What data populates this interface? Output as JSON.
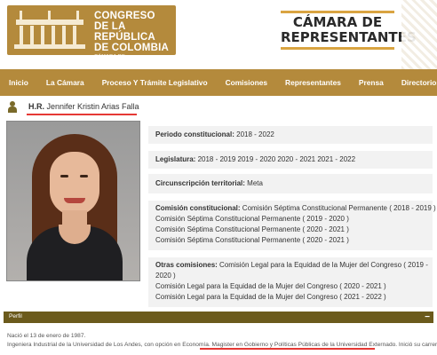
{
  "header": {
    "logo_line1": "CONGRESO",
    "logo_line2": "DE LA REPÚBLICA",
    "logo_line3": "DE COLOMBIA",
    "logo_line4": "CÁMARA DE REPRESENTANTES",
    "chamber_line1": "CÁMARA DE",
    "chamber_line2": "REPRESENTANTES"
  },
  "nav": {
    "items": [
      "Inicio",
      "La Cámara",
      "Proceso Y Trámite Legislativo",
      "Comisiones",
      "Representantes",
      "Prensa",
      "Directorios"
    ]
  },
  "profile": {
    "title": "H.R.",
    "name": "Jennifer Kristin Arias Falla",
    "periodo_label": "Periodo constitucional:",
    "periodo_value": "2018 - 2022",
    "legislatura_label": "Legislatura:",
    "legislatura_value": "2018 - 2019 2019 - 2020 2020 - 2021 2021 - 2022",
    "circunscripcion_label": "Circunscripción territorial:",
    "circunscripcion_value": "Meta",
    "comision_label": "Comisión constitucional:",
    "comision_lines": [
      "Comisión Séptima Constitucional Permanente ( 2018 - 2019 )",
      "Comisión Séptima Constitucional Permanente ( 2019 - 2020 )",
      "Comisión Séptima Constitucional Permanente ( 2020 - 2021 )",
      "Comisión Séptima Constitucional Permanente ( 2020 - 2021 )"
    ],
    "otras_label": "Otras comisiones:",
    "otras_lines": [
      "Comisión Legal para la Equidad de la Mujer del Congreso ( 2019 -",
      "2020 )",
      "Comisión Legal para la Equidad de la Mujer del Congreso ( 2020 - 2021 )",
      "Comisión Legal para la Equidad de la Mujer del Congreso ( 2021 - 2022 )"
    ]
  },
  "perfil": {
    "label": "Perfil",
    "toggle": "−",
    "line1": "Nació el 13 de enero de 1987.",
    "line2": "Ingeniera Industrial de la Universidad de Los Andes, con opción en Economía. Magister en Gobierno y Políticas Públicas de la Universidad Externado. Inició su carrera"
  },
  "colors": {
    "brand_gold": "#b48a3c",
    "perfil_bar": "#6b5a1c",
    "highlight_red": "#e53935"
  }
}
